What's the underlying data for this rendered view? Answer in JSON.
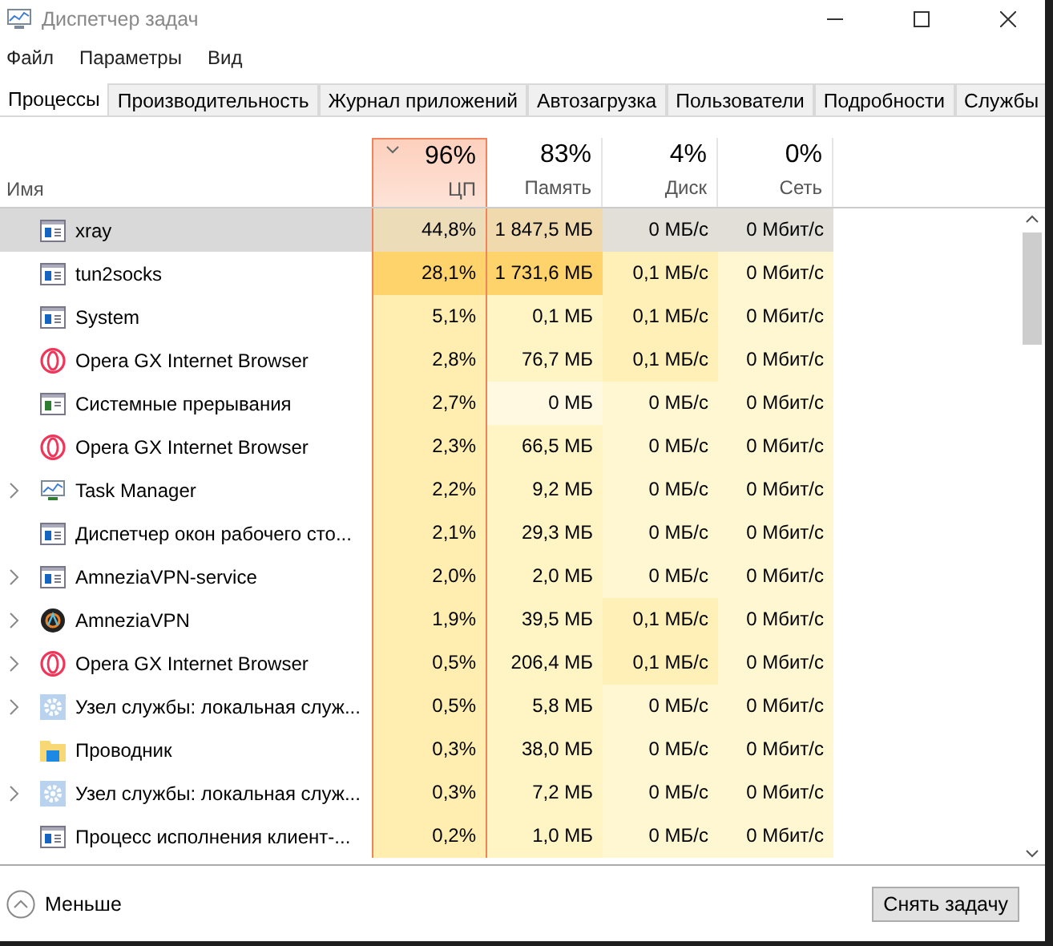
{
  "window": {
    "title": "Диспетчер задач"
  },
  "menu": [
    "Файл",
    "Параметры",
    "Вид"
  ],
  "tabs": [
    {
      "label": "Процессы",
      "selected": true
    },
    {
      "label": "Производительность",
      "selected": false
    },
    {
      "label": "Журнал приложений",
      "selected": false
    },
    {
      "label": "Автозагрузка",
      "selected": false
    },
    {
      "label": "Пользователи",
      "selected": false
    },
    {
      "label": "Подробности",
      "selected": false
    },
    {
      "label": "Службы",
      "selected": false
    }
  ],
  "name_column": {
    "label": "Имя"
  },
  "columns": [
    {
      "label": "ЦП",
      "total": "96%",
      "sorted": true
    },
    {
      "label": "Память",
      "total": "83%",
      "sorted": false
    },
    {
      "label": "Диск",
      "total": "4%",
      "sorted": false
    },
    {
      "label": "Сеть",
      "total": "0%",
      "sorted": false
    }
  ],
  "rows": [
    {
      "name": "xray",
      "kind": "app",
      "expandable": false,
      "selected": true,
      "cells": [
        {
          "text": "44,8%",
          "color": "#ecdcb8"
        },
        {
          "text": "1 847,5 МБ",
          "color": "#efd9ad"
        },
        {
          "text": "0 МБ/с",
          "color": "#e2dfd8"
        },
        {
          "text": "0 Мбит/с",
          "color": "#e2dfd8"
        }
      ]
    },
    {
      "name": "tun2socks",
      "kind": "app",
      "expandable": false,
      "selected": false,
      "cells": [
        {
          "text": "28,1%",
          "color": "#ffd36b"
        },
        {
          "text": "1 731,6 МБ",
          "color": "#ffd36b"
        },
        {
          "text": "0,1 МБ/с",
          "color": "#fff0b8"
        },
        {
          "text": "0 Мбит/с",
          "color": "#fff6d2"
        }
      ]
    },
    {
      "name": "System",
      "kind": "app",
      "expandable": false,
      "selected": false,
      "cells": [
        {
          "text": "5,1%",
          "color": "#ffeeb0"
        },
        {
          "text": "0,1 МБ",
          "color": "#fff4c4"
        },
        {
          "text": "0,1 МБ/с",
          "color": "#fff0b8"
        },
        {
          "text": "0 Мбит/с",
          "color": "#fff6d2"
        }
      ]
    },
    {
      "name": "Opera GX Internet Browser",
      "kind": "browser",
      "expandable": false,
      "selected": false,
      "cells": [
        {
          "text": "2,8%",
          "color": "#ffeeb0"
        },
        {
          "text": "76,7 МБ",
          "color": "#fff4c4"
        },
        {
          "text": "0,1 МБ/с",
          "color": "#fff0b8"
        },
        {
          "text": "0 Мбит/с",
          "color": "#fff6d2"
        }
      ]
    },
    {
      "name": "Системные прерывания",
      "kind": "system",
      "expandable": false,
      "selected": false,
      "cells": [
        {
          "text": "2,7%",
          "color": "#ffeeb0"
        },
        {
          "text": "0 МБ",
          "color": "#fff9e2"
        },
        {
          "text": "0 МБ/с",
          "color": "#fff6d2"
        },
        {
          "text": "0 Мбит/с",
          "color": "#fff6d2"
        }
      ]
    },
    {
      "name": "Opera GX Internet Browser",
      "kind": "browser",
      "expandable": false,
      "selected": false,
      "cells": [
        {
          "text": "2,3%",
          "color": "#ffeeb0"
        },
        {
          "text": "66,5 МБ",
          "color": "#fff4c4"
        },
        {
          "text": "0 МБ/с",
          "color": "#fff6d2"
        },
        {
          "text": "0 Мбит/с",
          "color": "#fff6d2"
        }
      ]
    },
    {
      "name": "Task Manager",
      "kind": "monitor",
      "expandable": true,
      "selected": false,
      "cells": [
        {
          "text": "2,2%",
          "color": "#ffeeb0"
        },
        {
          "text": "9,2 МБ",
          "color": "#fff4c4"
        },
        {
          "text": "0 МБ/с",
          "color": "#fff6d2"
        },
        {
          "text": "0 Мбит/с",
          "color": "#fff6d2"
        }
      ]
    },
    {
      "name": "Диспетчер окон рабочего сто...",
      "kind": "app",
      "expandable": false,
      "selected": false,
      "cells": [
        {
          "text": "2,1%",
          "color": "#ffeeb0"
        },
        {
          "text": "29,3 МБ",
          "color": "#fff4c4"
        },
        {
          "text": "0 МБ/с",
          "color": "#fff6d2"
        },
        {
          "text": "0 Мбит/с",
          "color": "#fff6d2"
        }
      ]
    },
    {
      "name": "AmneziaVPN-service",
      "kind": "app",
      "expandable": true,
      "selected": false,
      "cells": [
        {
          "text": "2,0%",
          "color": "#ffeeb0"
        },
        {
          "text": "2,0 МБ",
          "color": "#fff4c4"
        },
        {
          "text": "0 МБ/с",
          "color": "#fff6d2"
        },
        {
          "text": "0 Мбит/с",
          "color": "#fff6d2"
        }
      ]
    },
    {
      "name": "AmneziaVPN",
      "kind": "round",
      "expandable": true,
      "selected": false,
      "cells": [
        {
          "text": "1,9%",
          "color": "#ffeeb0"
        },
        {
          "text": "39,5 МБ",
          "color": "#fff4c4"
        },
        {
          "text": "0,1 МБ/с",
          "color": "#fff0b8"
        },
        {
          "text": "0 Мбит/с",
          "color": "#fff6d2"
        }
      ]
    },
    {
      "name": "Opera GX Internet Browser",
      "kind": "browser",
      "expandable": true,
      "selected": false,
      "cells": [
        {
          "text": "0,5%",
          "color": "#ffeeb0"
        },
        {
          "text": "206,4 МБ",
          "color": "#fff4c4"
        },
        {
          "text": "0,1 МБ/с",
          "color": "#fff0b8"
        },
        {
          "text": "0 Мбит/с",
          "color": "#fff6d2"
        }
      ]
    },
    {
      "name": "Узел службы: локальная служ...",
      "kind": "service",
      "expandable": true,
      "selected": false,
      "cells": [
        {
          "text": "0,5%",
          "color": "#ffeeb0"
        },
        {
          "text": "5,8 МБ",
          "color": "#fff4c4"
        },
        {
          "text": "0 МБ/с",
          "color": "#fff6d2"
        },
        {
          "text": "0 Мбит/с",
          "color": "#fff6d2"
        }
      ]
    },
    {
      "name": "Проводник",
      "kind": "explorer",
      "expandable": false,
      "selected": false,
      "cells": [
        {
          "text": "0,3%",
          "color": "#ffeeb0"
        },
        {
          "text": "38,0 МБ",
          "color": "#fff4c4"
        },
        {
          "text": "0 МБ/с",
          "color": "#fff6d2"
        },
        {
          "text": "0 Мбит/с",
          "color": "#fff6d2"
        }
      ]
    },
    {
      "name": "Узел службы: локальная служ...",
      "kind": "service",
      "expandable": true,
      "selected": false,
      "cells": [
        {
          "text": "0,3%",
          "color": "#ffeeb0"
        },
        {
          "text": "7,2 МБ",
          "color": "#fff4c4"
        },
        {
          "text": "0 МБ/с",
          "color": "#fff6d2"
        },
        {
          "text": "0 Мбит/с",
          "color": "#fff6d2"
        }
      ]
    },
    {
      "name": "Процесс исполнения клиент-...",
      "kind": "app",
      "expandable": false,
      "selected": false,
      "cells": [
        {
          "text": "0,2%",
          "color": "#ffeeb0"
        },
        {
          "text": "1,0 МБ",
          "color": "#fff4c4"
        },
        {
          "text": "0 МБ/с",
          "color": "#fff6d2"
        },
        {
          "text": "0 Мбит/с",
          "color": "#fff6d2"
        }
      ]
    }
  ],
  "footer": {
    "toggle": "Меньше",
    "button": "Снять задачу"
  }
}
